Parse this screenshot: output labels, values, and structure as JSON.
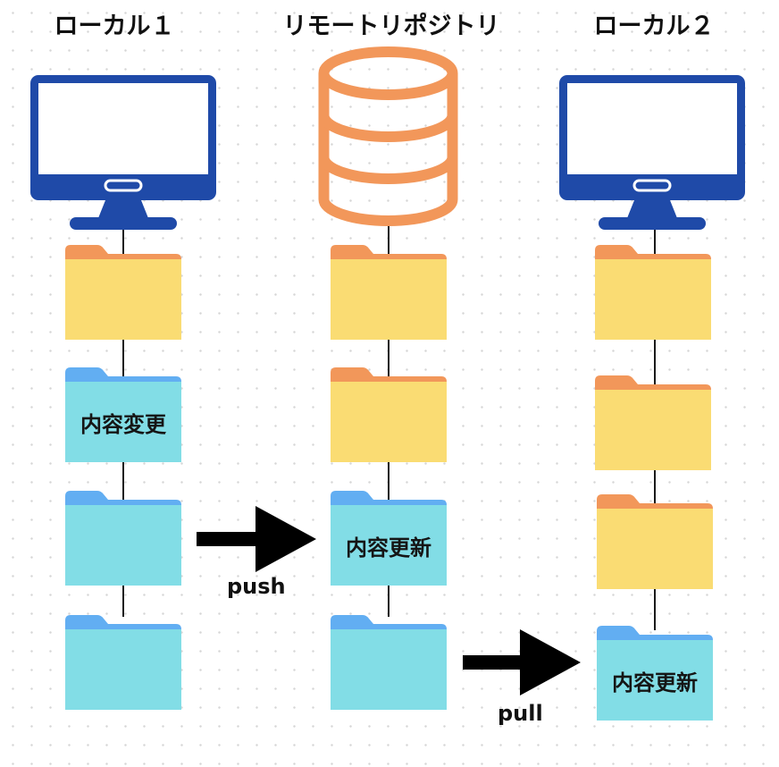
{
  "columns": [
    {
      "title": "ローカル１",
      "icon": "monitor-icon",
      "folders": [
        {
          "color": "yellow",
          "label": ""
        },
        {
          "color": "blue",
          "label": "内容変更"
        },
        {
          "color": "blue",
          "label": ""
        },
        {
          "color": "blue",
          "label": ""
        }
      ]
    },
    {
      "title": "リモートリポジトリ",
      "icon": "database-icon",
      "folders": [
        {
          "color": "yellow",
          "label": ""
        },
        {
          "color": "yellow",
          "label": ""
        },
        {
          "color": "blue",
          "label": "内容更新"
        },
        {
          "color": "blue",
          "label": ""
        }
      ]
    },
    {
      "title": "ローカル２",
      "icon": "monitor-icon",
      "folders": [
        {
          "color": "yellow",
          "label": ""
        },
        {
          "color": "yellow",
          "label": ""
        },
        {
          "color": "yellow",
          "label": ""
        },
        {
          "color": "blue",
          "label": "内容更新"
        }
      ]
    }
  ],
  "arrows": [
    {
      "label": "push"
    },
    {
      "label": "pull"
    }
  ],
  "colors": {
    "monitor": "#1f4aa8",
    "database": "#f2975a",
    "folder_yellow_body": "#fadc73",
    "folder_yellow_tab": "#f2975a",
    "folder_blue_body": "#82dde6",
    "folder_blue_tab": "#62aef2",
    "arrow": "#000000"
  }
}
